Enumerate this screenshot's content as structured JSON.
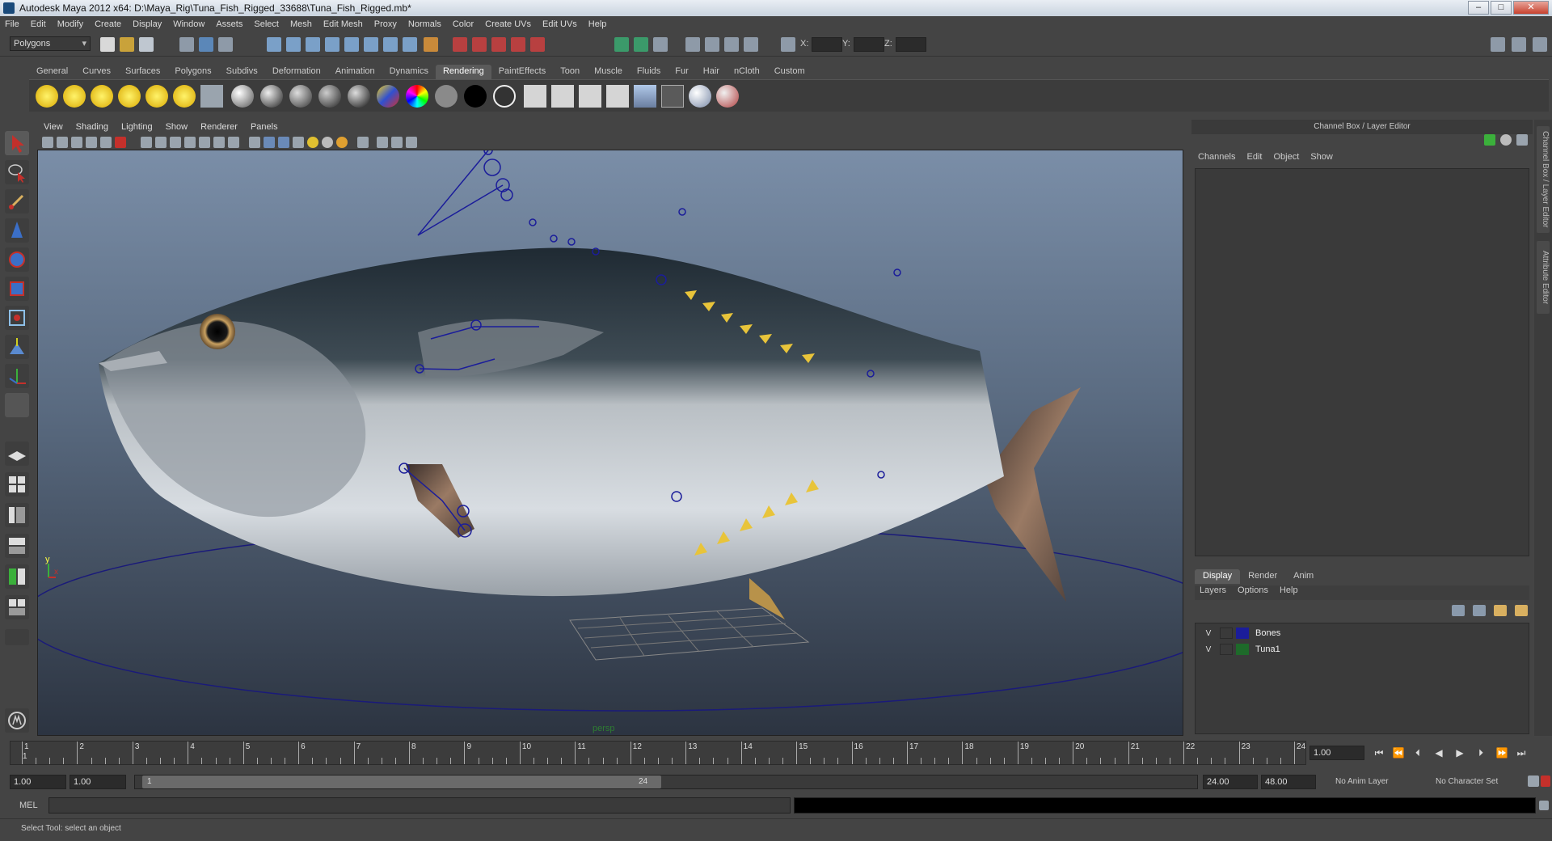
{
  "window": {
    "title": "Autodesk Maya 2012 x64: D:\\Maya_Rig\\Tuna_Fish_Rigged_33688\\Tuna_Fish_Rigged.mb*"
  },
  "menubar": [
    "File",
    "Edit",
    "Modify",
    "Create",
    "Display",
    "Window",
    "Assets",
    "Select",
    "Mesh",
    "Edit Mesh",
    "Proxy",
    "Normals",
    "Color",
    "Create UVs",
    "Edit UVs",
    "Help"
  ],
  "status_line": {
    "mode": "Polygons",
    "x_label": "X:",
    "y_label": "Y:",
    "z_label": "Z:"
  },
  "shelf_tabs": [
    "General",
    "Curves",
    "Surfaces",
    "Polygons",
    "Subdivs",
    "Deformation",
    "Animation",
    "Dynamics",
    "Rendering",
    "PaintEffects",
    "Toon",
    "Muscle",
    "Fluids",
    "Fur",
    "Hair",
    "nCloth",
    "Custom"
  ],
  "shelf_active": "Rendering",
  "viewport": {
    "menu": [
      "View",
      "Shading",
      "Lighting",
      "Show",
      "Renderer",
      "Panels"
    ],
    "camera": "persp",
    "axis_y": "y",
    "axis_x": "x"
  },
  "channel_box": {
    "title": "Channel Box / Layer Editor",
    "menu": [
      "Channels",
      "Edit",
      "Object",
      "Show"
    ]
  },
  "layer_editor": {
    "tabs": [
      "Display",
      "Render",
      "Anim"
    ],
    "active_tab": "Display",
    "menu": [
      "Layers",
      "Options",
      "Help"
    ],
    "layers": [
      {
        "visible": "V",
        "color": "#1b1d9a",
        "name": "Bones"
      },
      {
        "visible": "V",
        "color": "#1e6a2a",
        "name": "Tuna1"
      }
    ]
  },
  "side_tabs": [
    "Channel Box / Layer Editor",
    "Attribute Editor"
  ],
  "timeline": {
    "ticks": [
      "1",
      "2",
      "3",
      "4",
      "5",
      "6",
      "7",
      "8",
      "9",
      "10",
      "11",
      "12",
      "13",
      "14",
      "15",
      "16",
      "17",
      "18",
      "19",
      "20",
      "21",
      "22",
      "23",
      "24"
    ],
    "current_marker": "1",
    "current_frame": "1.00"
  },
  "range": {
    "start": "1.00",
    "playback_start": "1.00",
    "slider_start": "1",
    "slider_end": "24",
    "playback_end": "24.00",
    "end": "48.00",
    "anim_layer": "No Anim Layer",
    "character_set": "No Character Set"
  },
  "command_line": {
    "label": "MEL"
  },
  "help_line": {
    "text": "Select Tool: select an object"
  },
  "colors": {
    "fish_back": "#1f2a33",
    "fish_belly": "#d8dde2",
    "finlets": "#e8c43a",
    "bones": "#1b1d9a",
    "control_curve": "#1a1a7a"
  }
}
